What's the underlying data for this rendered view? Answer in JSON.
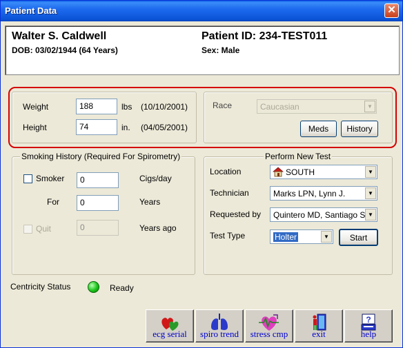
{
  "window": {
    "title": "Patient Data",
    "close_glyph": "✕"
  },
  "patient": {
    "name": "Walter S. Caldwell",
    "dob": "DOB:  03/02/1944 (64 Years)",
    "id": "Patient ID:  234-TEST011",
    "sex": "Sex: Male"
  },
  "vitals": {
    "weight_label": "Weight",
    "weight_value": "188",
    "weight_unit": "lbs",
    "weight_date": "(10/10/2001)",
    "height_label": "Height",
    "height_value": "74",
    "height_unit": "in.",
    "height_date": "(04/05/2001)"
  },
  "race": {
    "label": "Race",
    "value": "Caucasian",
    "disabled": true,
    "meds_button": "Meds",
    "history_button": "History"
  },
  "smoking": {
    "legend": "Smoking History (Required For Spirometry)",
    "smoker_label": "Smoker",
    "smoker_checked": false,
    "cigs_value": "0",
    "cigs_unit": "Cigs/day",
    "for_label": "For",
    "for_value": "0",
    "for_unit": "Years",
    "quit_label": "Quit",
    "quit_checked": false,
    "quit_value": "0",
    "quit_unit": "Years ago"
  },
  "test": {
    "legend": "Perform New Test",
    "location_label": "Location",
    "location_value": "SOUTH",
    "location_icon": "house-icon",
    "technician_label": "Technician",
    "technician_value": "Marks LPN, Lynn J.",
    "requested_label": "Requested by",
    "requested_value": "Quintero MD, Santiago S",
    "type_label": "Test Type",
    "type_value": "Holter",
    "start_button": "Start"
  },
  "status": {
    "label": "Centricity Status",
    "value": "Ready",
    "indicator_color": "#19C41A"
  },
  "toolbar": [
    {
      "label": "ecg serial",
      "icon": "hearts-icon"
    },
    {
      "label": "spiro trend",
      "icon": "lungs-icon"
    },
    {
      "label": "stress cmp",
      "icon": "heart-pulse-icon"
    },
    {
      "label": "exit",
      "icon": "exit-door-icon"
    },
    {
      "label": "help",
      "icon": "help-icon"
    }
  ],
  "colors": {
    "title_bar": "#0A53D6",
    "highlight_outline": "#D40000",
    "link_text": "#0000CC",
    "selection": "#316AC5"
  }
}
